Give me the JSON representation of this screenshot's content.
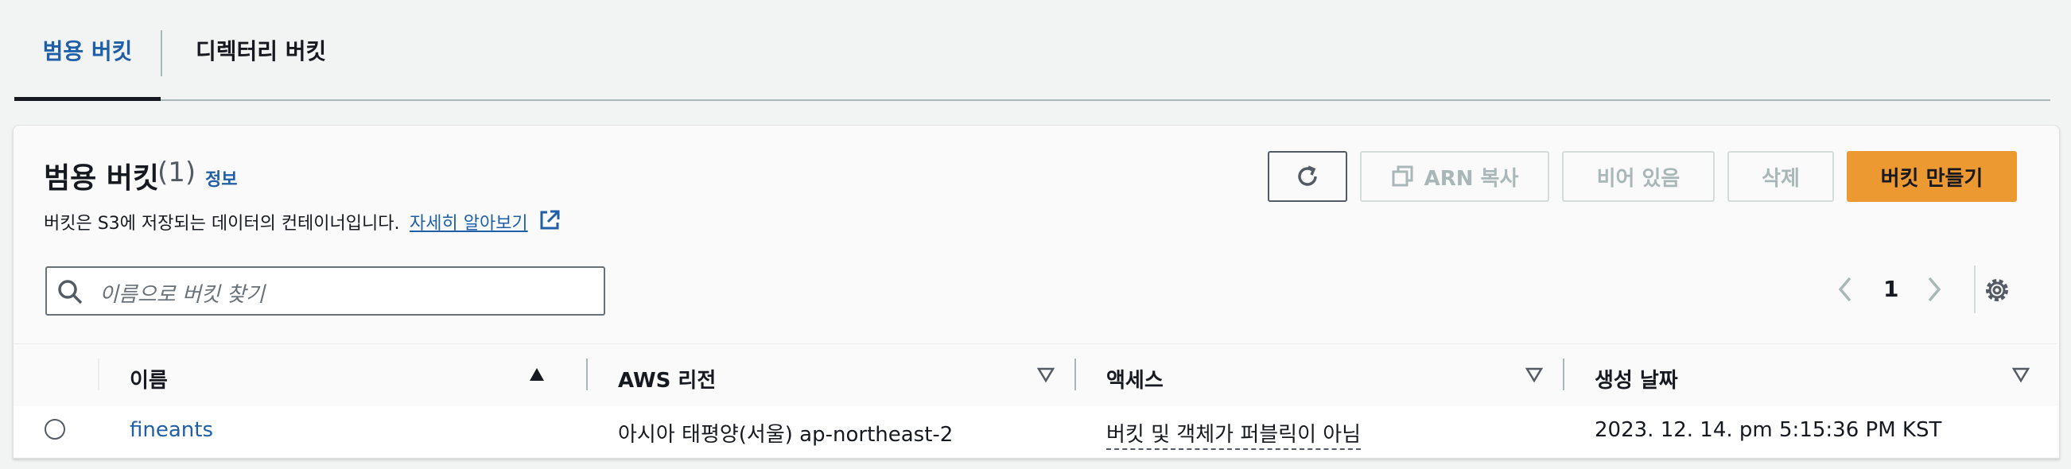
{
  "tabs": [
    {
      "label": "범용 버킷",
      "active": true
    },
    {
      "label": "디렉터리 버킷",
      "active": false
    }
  ],
  "header": {
    "title": "범용 버킷",
    "count": "(1)",
    "info_link": "정보",
    "description": "버킷은 S3에 저장되는 데이터의 컨테이너입니다.",
    "learn_more": "자세히 알아보기"
  },
  "actions": {
    "refresh_icon": "refresh-icon",
    "copy_arn": "ARN 복사",
    "empty": "비어 있음",
    "delete": "삭제",
    "create": "버킷 만들기"
  },
  "search": {
    "placeholder": "이름으로 버킷 찾기",
    "value": ""
  },
  "pagination": {
    "current_page": "1"
  },
  "table": {
    "columns": [
      "이름",
      "AWS 리전",
      "액세스",
      "생성 날짜"
    ],
    "sort_column": "이름",
    "rows": [
      {
        "name": "fineants",
        "region": "아시아 태평양(서울) ap-northeast-2",
        "access": "버킷 및 객체가 퍼블릭이 아님",
        "created": "2023. 12. 14. pm 5:15:36 PM KST"
      }
    ]
  },
  "colors": {
    "accent": "#1f5fa8",
    "primary_button": "#ec9932",
    "disabled_text": "#aab7b8"
  }
}
